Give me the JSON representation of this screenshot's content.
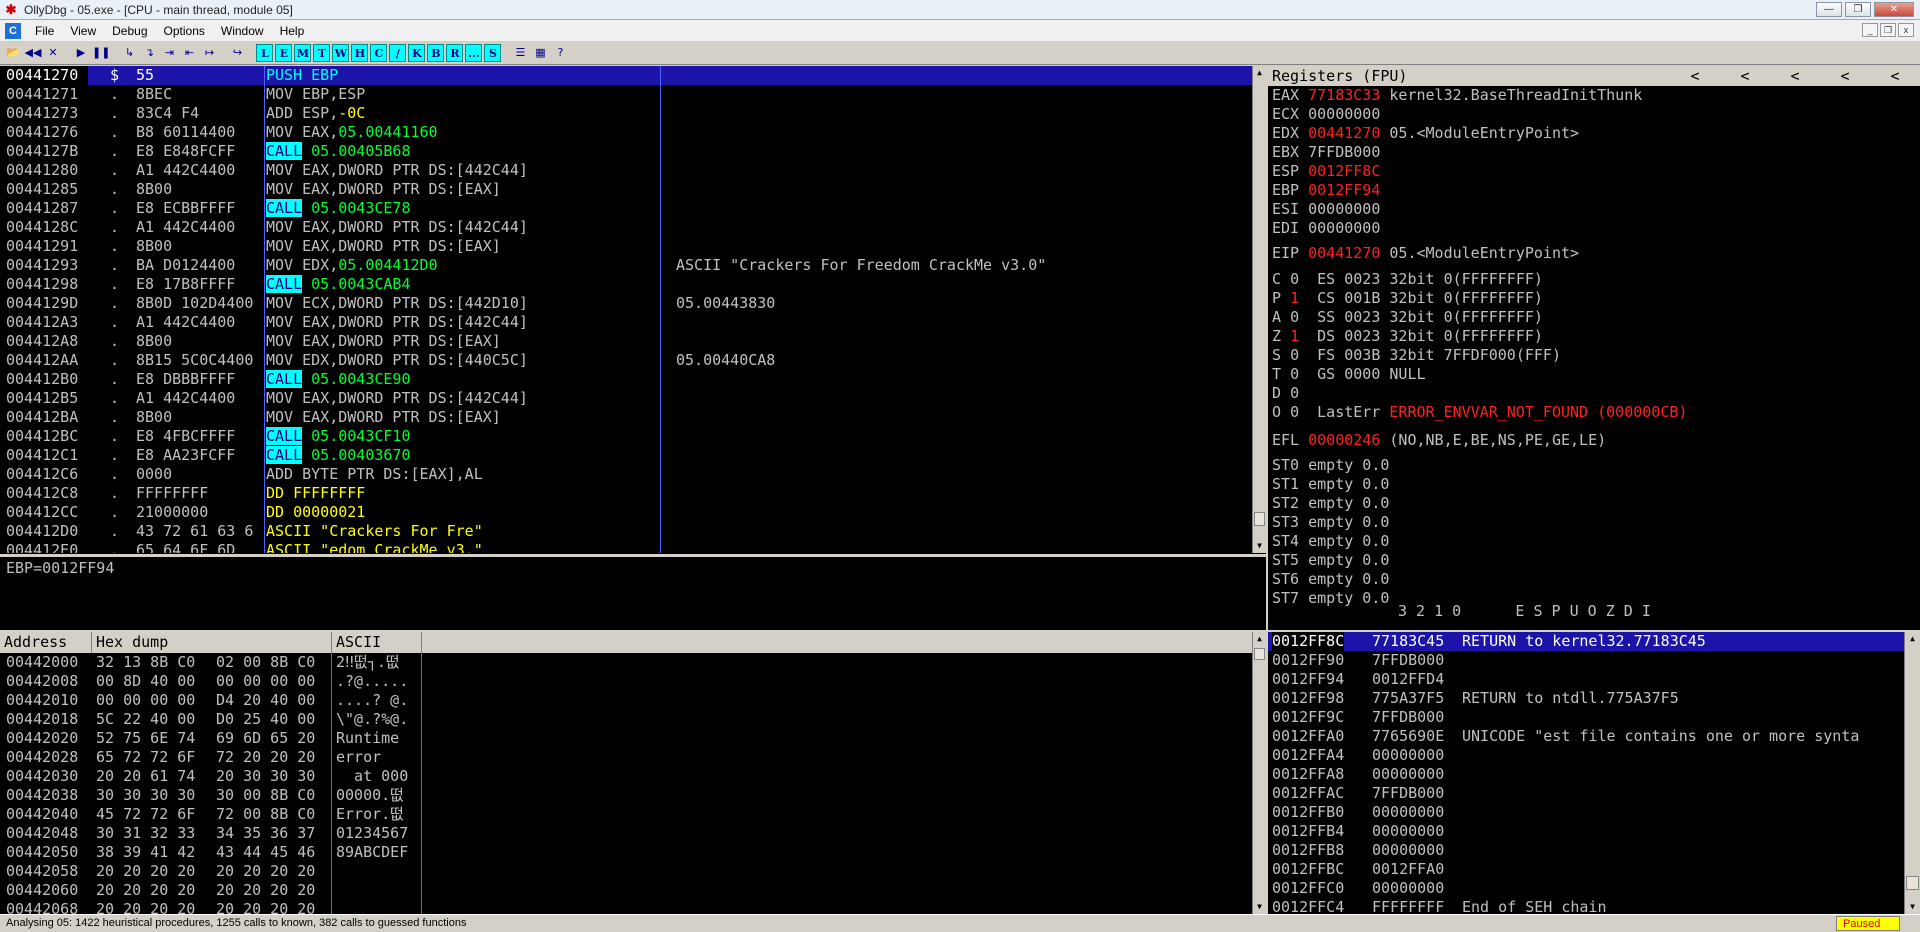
{
  "window": {
    "title": "OllyDbg - 05.exe - [CPU - main thread, module 05]",
    "min": "—",
    "restore": "❐",
    "close": "✕"
  },
  "menu": [
    "File",
    "View",
    "Debug",
    "Options",
    "Window",
    "Help"
  ],
  "toolbar": {
    "buttons": [
      "📂",
      "◀◀",
      "✕",
      "▶",
      "❚❚",
      "↳",
      "↴",
      "⇥",
      "⇤",
      "↦",
      "↪"
    ],
    "letters": [
      "L",
      "E",
      "M",
      "T",
      "W",
      "H",
      "C",
      "/",
      "K",
      "B",
      "R",
      "...",
      "S"
    ],
    "views": [
      "☰",
      "▦",
      "?"
    ]
  },
  "disassembly": [
    {
      "addr": "00441270",
      "mark": "$",
      "hex": "55",
      "ins": "PUSH EBP",
      "ins_style": "sel",
      "cmt": ""
    },
    {
      "addr": "00441271",
      "mark": ".",
      "hex": "8BEC",
      "ins": "MOV EBP,ESP",
      "cmt": ""
    },
    {
      "addr": "00441273",
      "mark": ".",
      "hex": "83C4 F4",
      "ins_pre": "ADD ESP,",
      "ins_post": "-0C",
      "post_style": "yellow",
      "cmt": ""
    },
    {
      "addr": "00441276",
      "mark": ".",
      "hex": "B8 60114400",
      "ins_pre": "MOV EAX,",
      "ins_post": "05.00441160",
      "post_style": "green",
      "cmt": ""
    },
    {
      "addr": "0044127B",
      "mark": ".",
      "hex": "E8 E848FCFF",
      "call": "CALL",
      "target": "05.00405B68",
      "cmt": ""
    },
    {
      "addr": "00441280",
      "mark": ".",
      "hex": "A1 442C4400",
      "ins": "MOV EAX,DWORD PTR DS:[442C44]",
      "cmt": ""
    },
    {
      "addr": "00441285",
      "mark": ".",
      "hex": "8B00",
      "ins": "MOV EAX,DWORD PTR DS:[EAX]",
      "cmt": ""
    },
    {
      "addr": "00441287",
      "mark": ".",
      "hex": "E8 ECBBFFFF",
      "call": "CALL",
      "target": "05.0043CE78",
      "cmt": ""
    },
    {
      "addr": "0044128C",
      "mark": ".",
      "hex": "A1 442C4400",
      "ins": "MOV EAX,DWORD PTR DS:[442C44]",
      "cmt": ""
    },
    {
      "addr": "00441291",
      "mark": ".",
      "hex": "8B00",
      "ins": "MOV EAX,DWORD PTR DS:[EAX]",
      "cmt": ""
    },
    {
      "addr": "00441293",
      "mark": ".",
      "hex": "BA D0124400",
      "ins_pre": "MOV EDX,",
      "ins_post": "05.004412D0",
      "post_style": "green",
      "cmt": "ASCII \"Crackers For Freedom CrackMe v3.0\""
    },
    {
      "addr": "00441298",
      "mark": ".",
      "hex": "E8 17B8FFFF",
      "call": "CALL",
      "target": "05.0043CAB4",
      "cmt": ""
    },
    {
      "addr": "0044129D",
      "mark": ".",
      "hex": "8B0D 102D4400",
      "ins": "MOV ECX,DWORD PTR DS:[442D10]",
      "cmt": "05.00443830"
    },
    {
      "addr": "004412A3",
      "mark": ".",
      "hex": "A1 442C4400",
      "ins": "MOV EAX,DWORD PTR DS:[442C44]",
      "cmt": ""
    },
    {
      "addr": "004412A8",
      "mark": ".",
      "hex": "8B00",
      "ins": "MOV EAX,DWORD PTR DS:[EAX]",
      "cmt": ""
    },
    {
      "addr": "004412AA",
      "mark": ".",
      "hex": "8B15 5C0C4400",
      "ins": "MOV EDX,DWORD PTR DS:[440C5C]",
      "cmt": "05.00440CA8"
    },
    {
      "addr": "004412B0",
      "mark": ".",
      "hex": "E8 DBBBFFFF",
      "call": "CALL",
      "target": "05.0043CE90",
      "cmt": ""
    },
    {
      "addr": "004412B5",
      "mark": ".",
      "hex": "A1 442C4400",
      "ins": "MOV EAX,DWORD PTR DS:[442C44]",
      "cmt": ""
    },
    {
      "addr": "004412BA",
      "mark": ".",
      "hex": "8B00",
      "ins": "MOV EAX,DWORD PTR DS:[EAX]",
      "cmt": ""
    },
    {
      "addr": "004412BC",
      "mark": ".",
      "hex": "E8 4FBCFFFF",
      "call": "CALL",
      "target": "05.0043CF10",
      "cmt": ""
    },
    {
      "addr": "004412C1",
      "mark": ".",
      "hex": "E8 AA23FCFF",
      "call": "CALL",
      "target": "05.00403670",
      "cmt": ""
    },
    {
      "addr": "004412C6",
      "mark": ".",
      "hex": "0000",
      "ins": "ADD BYTE PTR DS:[EAX],AL",
      "cmt": ""
    },
    {
      "addr": "004412C8",
      "mark": ".",
      "hex": "FFFFFFFF",
      "ins": "DD FFFFFFFF",
      "ins_style": "yellow",
      "cmt": ""
    },
    {
      "addr": "004412CC",
      "mark": ".",
      "hex": "21000000",
      "ins": "DD 00000021",
      "ins_style": "yellow",
      "cmt": ""
    },
    {
      "addr": "004412D0",
      "mark": ".",
      "hex": "43 72 61 63 6",
      "ins": "ASCII \"Crackers For Fre\"",
      "ins_style": "yellow",
      "cmt": ""
    },
    {
      "addr": "004412E0",
      "mark": ".",
      "hex": "65 64 6F 6D",
      "ins": "ASCII \"edom CrackMe v3.\"",
      "ins_style": "yellow",
      "cmt": ""
    }
  ],
  "info": "EBP=0012FF94",
  "registers": {
    "title": "Registers (FPU)",
    "arrows": [
      "<",
      "<",
      "<",
      "<",
      "<"
    ],
    "gpr": [
      {
        "name": "EAX",
        "val": "77183C33",
        "red": true,
        "desc": "kernel32.BaseThreadInitThunk"
      },
      {
        "name": "ECX",
        "val": "00000000",
        "red": false,
        "desc": ""
      },
      {
        "name": "EDX",
        "val": "00441270",
        "red": true,
        "desc": "05.<ModuleEntryPoint>"
      },
      {
        "name": "EBX",
        "val": "7FFDB000",
        "red": false,
        "desc": ""
      },
      {
        "name": "ESP",
        "val": "0012FF8C",
        "red": true,
        "desc": ""
      },
      {
        "name": "EBP",
        "val": "0012FF94",
        "red": true,
        "desc": ""
      },
      {
        "name": "ESI",
        "val": "00000000",
        "red": false,
        "desc": ""
      },
      {
        "name": "EDI",
        "val": "00000000",
        "red": false,
        "desc": ""
      }
    ],
    "eip": {
      "name": "EIP",
      "val": "00441270",
      "desc": "05.<ModuleEntryPoint>"
    },
    "flags": [
      {
        "f": "C",
        "v": "0",
        "red": false,
        "seg": "ES 0023 32bit 0(FFFFFFFF)"
      },
      {
        "f": "P",
        "v": "1",
        "red": true,
        "seg": "CS 001B 32bit 0(FFFFFFFF)"
      },
      {
        "f": "A",
        "v": "0",
        "red": false,
        "seg": "SS 0023 32bit 0(FFFFFFFF)"
      },
      {
        "f": "Z",
        "v": "1",
        "red": true,
        "seg": "DS 0023 32bit 0(FFFFFFFF)"
      },
      {
        "f": "S",
        "v": "0",
        "red": false,
        "seg": "FS 003B 32bit 7FFDF000(FFF)"
      },
      {
        "f": "T",
        "v": "0",
        "red": false,
        "seg": "GS 0000 NULL"
      },
      {
        "f": "D",
        "v": "0",
        "red": false,
        "seg": ""
      },
      {
        "f": "O",
        "v": "0",
        "red": false,
        "seg": "LastErr"
      }
    ],
    "lasterr": "ERROR_ENVVAR_NOT_FOUND (000000CB)",
    "efl": {
      "name": "EFL",
      "val": "00000246",
      "desc": "(NO,NB,E,BE,NS,PE,GE,LE)"
    },
    "fpu": [
      "ST0 empty 0.0",
      "ST1 empty 0.0",
      "ST2 empty 0.0",
      "ST3 empty 0.0",
      "ST4 empty 0.0",
      "ST5 empty 0.0",
      "ST6 empty 0.0",
      "ST7 empty 0.0"
    ],
    "fpu_tail": "3 2 1 0      E S P U O Z D I"
  },
  "dump": {
    "headers": [
      "Address",
      "Hex dump",
      "ASCII"
    ],
    "rows": [
      {
        "addr": "00442000",
        "h1": "32 13 8B C0",
        "h2": "02 00 8B C0",
        "ascii": "2‼떲┐.떲"
      },
      {
        "addr": "00442008",
        "h1": "00 8D 40 00",
        "h2": "00 00 00 00",
        "ascii": ".?@....."
      },
      {
        "addr": "00442010",
        "h1": "00 00 00 00",
        "h2": "D4 20 40 00",
        "ascii": "....? @."
      },
      {
        "addr": "00442018",
        "h1": "5C 22 40 00",
        "h2": "D0 25 40 00",
        "ascii": "\\\"@.?%@."
      },
      {
        "addr": "00442020",
        "h1": "52 75 6E 74",
        "h2": "69 6D 65 20",
        "ascii": "Runtime "
      },
      {
        "addr": "00442028",
        "h1": "65 72 72 6F",
        "h2": "72 20 20 20",
        "ascii": "error   "
      },
      {
        "addr": "00442030",
        "h1": "20 20 61 74",
        "h2": "20 30 30 30",
        "ascii": "  at 000"
      },
      {
        "addr": "00442038",
        "h1": "30 30 30 30",
        "h2": "30 00 8B C0",
        "ascii": "00000.떲"
      },
      {
        "addr": "00442040",
        "h1": "45 72 72 6F",
        "h2": "72 00 8B C0",
        "ascii": "Error.떲"
      },
      {
        "addr": "00442048",
        "h1": "30 31 32 33",
        "h2": "34 35 36 37",
        "ascii": "01234567"
      },
      {
        "addr": "00442050",
        "h1": "38 39 41 42",
        "h2": "43 44 45 46",
        "ascii": "89ABCDEF"
      },
      {
        "addr": "00442058",
        "h1": "20 20 20 20",
        "h2": "20 20 20 20",
        "ascii": "        "
      },
      {
        "addr": "00442060",
        "h1": "20 20 20 20",
        "h2": "20 20 20 20",
        "ascii": "        "
      },
      {
        "addr": "00442068",
        "h1": "20 20 20 20",
        "h2": "20 20 20 20",
        "ascii": "        "
      }
    ]
  },
  "stack": [
    {
      "addr": "0012FF8C",
      "val": "77183C45",
      "cmt": "RETURN to kernel32.77183C45",
      "sel": true
    },
    {
      "addr": "0012FF90",
      "val": "7FFDB000",
      "cmt": ""
    },
    {
      "addr": "0012FF94",
      "val": "0012FFD4",
      "cmt": ""
    },
    {
      "addr": "0012FF98",
      "val": "775A37F5",
      "cmt": "RETURN to ntdll.775A37F5"
    },
    {
      "addr": "0012FF9C",
      "val": "7FFDB000",
      "cmt": ""
    },
    {
      "addr": "0012FFA0",
      "val": "7765690E",
      "cmt": "UNICODE \"est file contains one or more synta"
    },
    {
      "addr": "0012FFA4",
      "val": "00000000",
      "cmt": ""
    },
    {
      "addr": "0012FFA8",
      "val": "00000000",
      "cmt": ""
    },
    {
      "addr": "0012FFAC",
      "val": "7FFDB000",
      "cmt": ""
    },
    {
      "addr": "0012FFB0",
      "val": "00000000",
      "cmt": ""
    },
    {
      "addr": "0012FFB4",
      "val": "00000000",
      "cmt": ""
    },
    {
      "addr": "0012FFB8",
      "val": "00000000",
      "cmt": ""
    },
    {
      "addr": "0012FFBC",
      "val": "0012FFA0",
      "cmt": ""
    },
    {
      "addr": "0012FFC0",
      "val": "00000000",
      "cmt": ""
    },
    {
      "addr": "0012FFC4",
      "val": "FFFFFFFF",
      "cmt": "End of SEH chain"
    }
  ],
  "status": {
    "text": "Analysing 05: 1422 heuristical procedures, 1255 calls to known, 382 calls to guessed functions",
    "state": "Paused"
  }
}
